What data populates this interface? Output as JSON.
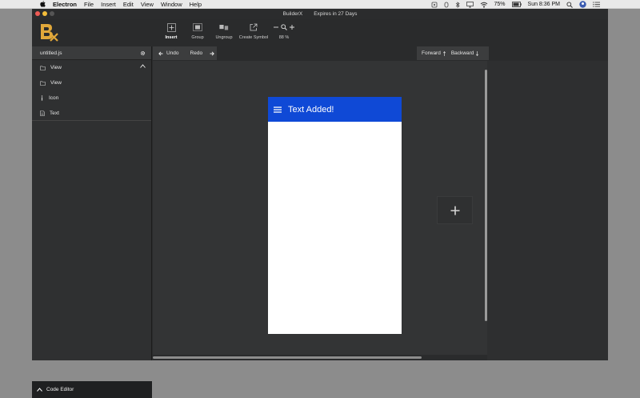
{
  "menubar": {
    "app_name": "Electron",
    "items": [
      "File",
      "Insert",
      "Edit",
      "View",
      "Window",
      "Help"
    ],
    "battery": "75%",
    "clock": "Sun 8:36 PM"
  },
  "window": {
    "title": "BuilderX",
    "license": "Expires in 27 Days"
  },
  "toolbar": {
    "insert": "Insert",
    "group": "Group",
    "ungroup": "Ungroup",
    "create_symbol": "Create Symbol",
    "zoom": "88 %"
  },
  "sidebar": {
    "file_name": "untitled.js",
    "layers": [
      {
        "icon": "folder-icon",
        "label": "View"
      },
      {
        "icon": "folder-icon",
        "label": "View"
      },
      {
        "icon": "info-icon",
        "label": "Icon"
      },
      {
        "icon": "document-icon",
        "label": "Text"
      }
    ],
    "code_editor": "Code Editor"
  },
  "canvas_bar": {
    "undo": "Undo",
    "redo": "Redo",
    "forward": "Forward",
    "backward": "Backward"
  },
  "artboard": {
    "appbar_title": "Text Added!",
    "accent": "#0f49d6"
  }
}
